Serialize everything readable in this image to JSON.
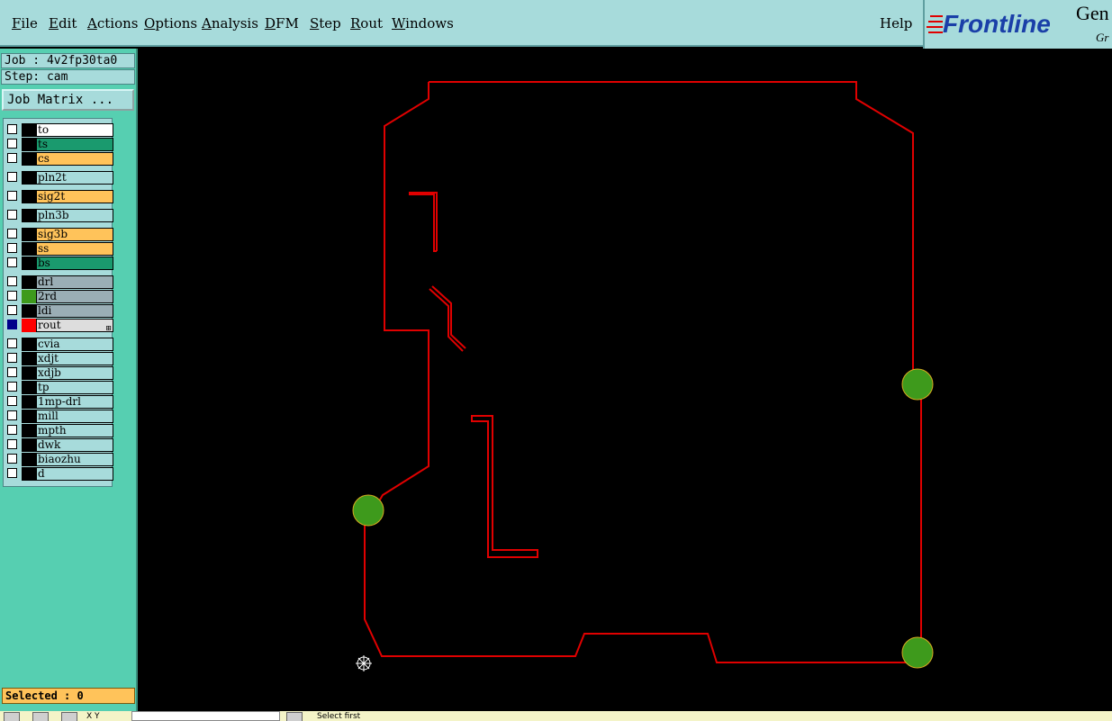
{
  "menu": {
    "items": [
      "File",
      "Edit",
      "Actions",
      "Options",
      "Analysis",
      "DFM",
      "Step",
      "Rout",
      "Windows"
    ],
    "help": "Help"
  },
  "logo": {
    "brand": "Frontline",
    "product": "Gen",
    "sub": "Gr"
  },
  "job": {
    "label": "Job : 4v2fp30ta0",
    "step": "Step: cam"
  },
  "job_matrix_button": "Job Matrix ...",
  "layers": [
    {
      "name": "to",
      "color": "#ffffff",
      "swatch": "#000000",
      "active": false
    },
    {
      "name": "ts",
      "color": "#1a9a6e",
      "swatch": "#000000",
      "active": false
    },
    {
      "name": "cs",
      "color": "#ffc35a",
      "swatch": "#000000",
      "active": false
    },
    {
      "name": "pln2t",
      "color": "#a7dbdb",
      "swatch": "#000000",
      "active": false
    },
    {
      "name": "sig2t",
      "color": "#ffc35a",
      "swatch": "#000000",
      "active": false
    },
    {
      "name": "pln3b",
      "color": "#a7dbdb",
      "swatch": "#000000",
      "active": false
    },
    {
      "name": "sig3b",
      "color": "#ffc35a",
      "swatch": "#000000",
      "active": false
    },
    {
      "name": "ss",
      "color": "#ffc35a",
      "swatch": "#000000",
      "active": false
    },
    {
      "name": "bs",
      "color": "#1a9a6e",
      "swatch": "#000000",
      "active": false
    },
    {
      "name": "drl",
      "color": "#9aaeb5",
      "swatch": "#000000",
      "active": false
    },
    {
      "name": "2rd",
      "color": "#9aaeb5",
      "swatch": "#3e9a1c",
      "active": false
    },
    {
      "name": "ldi",
      "color": "#9aaeb5",
      "swatch": "#000000",
      "active": false
    },
    {
      "name": "rout",
      "color": "#dddddd",
      "swatch": "#ff0000",
      "active": true
    },
    {
      "name": "cvia",
      "color": "#a7dbdb",
      "swatch": "#000000",
      "active": false
    },
    {
      "name": "xdjt",
      "color": "#a7dbdb",
      "swatch": "#000000",
      "active": false
    },
    {
      "name": "xdjb",
      "color": "#a7dbdb",
      "swatch": "#000000",
      "active": false
    },
    {
      "name": "tp",
      "color": "#a7dbdb",
      "swatch": "#000000",
      "active": false
    },
    {
      "name": "1mp-drl",
      "color": "#a7dbdb",
      "swatch": "#000000",
      "active": false
    },
    {
      "name": "mill",
      "color": "#a7dbdb",
      "swatch": "#000000",
      "active": false
    },
    {
      "name": "mpth",
      "color": "#a7dbdb",
      "swatch": "#000000",
      "active": false
    },
    {
      "name": "dwk",
      "color": "#a7dbdb",
      "swatch": "#000000",
      "active": false
    },
    {
      "name": "biaozhu",
      "color": "#a7dbdb",
      "swatch": "#000000",
      "active": false
    },
    {
      "name": "d",
      "color": "#a7dbdb",
      "swatch": "#000000",
      "active": false
    }
  ],
  "selected": "Selected : 0",
  "status": {
    "xy": "X Y",
    "message": "Select first"
  },
  "colors": {
    "outline": "#e00000",
    "pads": "#3e9a1c",
    "canvas": "#000000"
  }
}
